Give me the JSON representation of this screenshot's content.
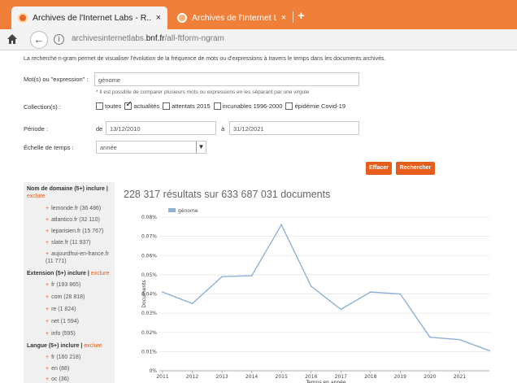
{
  "browser": {
    "tabs": [
      {
        "title": "Archives de l'Internet Labs - R...",
        "close": "×"
      },
      {
        "title": "Archives de l'Internet Labs - Ac...",
        "close": "×"
      }
    ],
    "new_tab": "+",
    "url_domain": "archivesinternetlabs.",
    "url_bold": "bnf.fr",
    "url_path": "/all-ftform-ngram",
    "back_glyph": "←",
    "info_glyph": "i"
  },
  "page": {
    "intro": "La recherche n-gram permet de visualiser l'évolution de la fréquence de mots ou d'expressions à travers le temps dans les documents archivés.",
    "words_label": "Mot(s) ou \"expression\" :",
    "words_value": "génome",
    "words_hint": "* Il est possible de comparer plusieurs mots ou expressions en les séparant par une virgule",
    "collection_label": "Collection(s) :",
    "collections": [
      {
        "label": "toutes",
        "checked": false
      },
      {
        "label": "actualités",
        "checked": true
      },
      {
        "label": "attentats 2015",
        "checked": false
      },
      {
        "label": "incunables 1996-2000",
        "checked": false
      },
      {
        "label": "épidémie Covid-19",
        "checked": false
      }
    ],
    "period_label": "Période :",
    "de_label": "de",
    "date_from": "13/12/2010",
    "a_label": "à",
    "date_to": "31/12/2021",
    "scale_label": "Échelle de temps :",
    "scale_value": "année",
    "select_arrow": "▼",
    "clear_button": "Effacer",
    "search_button": "Rechercher"
  },
  "sidebar": {
    "domain_header": "Nom de domaine (5+) inclure |",
    "domain_exclude": "exclure",
    "domains": [
      "lemonde.fr (36 486)",
      "atlantico.fr (32 110)",
      "leparisien.fr (15 767)",
      "slate.fr (11 937)",
      "aujourdhui-en-france.fr (11 771)"
    ],
    "ext_header": "Extension (5+) inclure |",
    "ext_exclude": "exclure",
    "extensions": [
      "fr (193 865)",
      "com (28 818)",
      "re (1 824)",
      "net (1 594)",
      "info (595)"
    ],
    "lang_header": "Langue (5+) inclure |",
    "lang_exclude": "exclure",
    "languages": [
      "fr (160 218)",
      "en (88)",
      "oc (36)"
    ],
    "plus": "+"
  },
  "results": {
    "summary": "228 317 résultats sur 633 687 031 documents"
  },
  "colors": {
    "orange": "#e85d1c",
    "line": "#8fb1d6",
    "tabbar": "#f07f3a"
  },
  "chart_data": {
    "type": "line",
    "x": [
      2011,
      2012,
      2013,
      2014,
      2015,
      2016,
      2017,
      2018,
      2019,
      2020,
      2021,
      2022
    ],
    "series": [
      {
        "name": "génome",
        "values": [
          0.041,
          0.035,
          0.049,
          0.0495,
          0.076,
          0.044,
          0.032,
          0.041,
          0.04,
          0.0175,
          0.0162,
          0.0105
        ]
      }
    ],
    "xticks": [
      "2011",
      "2012",
      "2013",
      "2014",
      "2015",
      "2016",
      "2017",
      "2018",
      "2019",
      "2020",
      "2021"
    ],
    "yticks": [
      "0%",
      "0.01%",
      "0.02%",
      "0.03%",
      "0.04%",
      "0.05%",
      "0.06%",
      "0.07%",
      "0.08%"
    ],
    "ylim": [
      0,
      0.08
    ],
    "xlabel": "Temps en année",
    "ylabel": "Documents",
    "legend_position": "top-left"
  }
}
